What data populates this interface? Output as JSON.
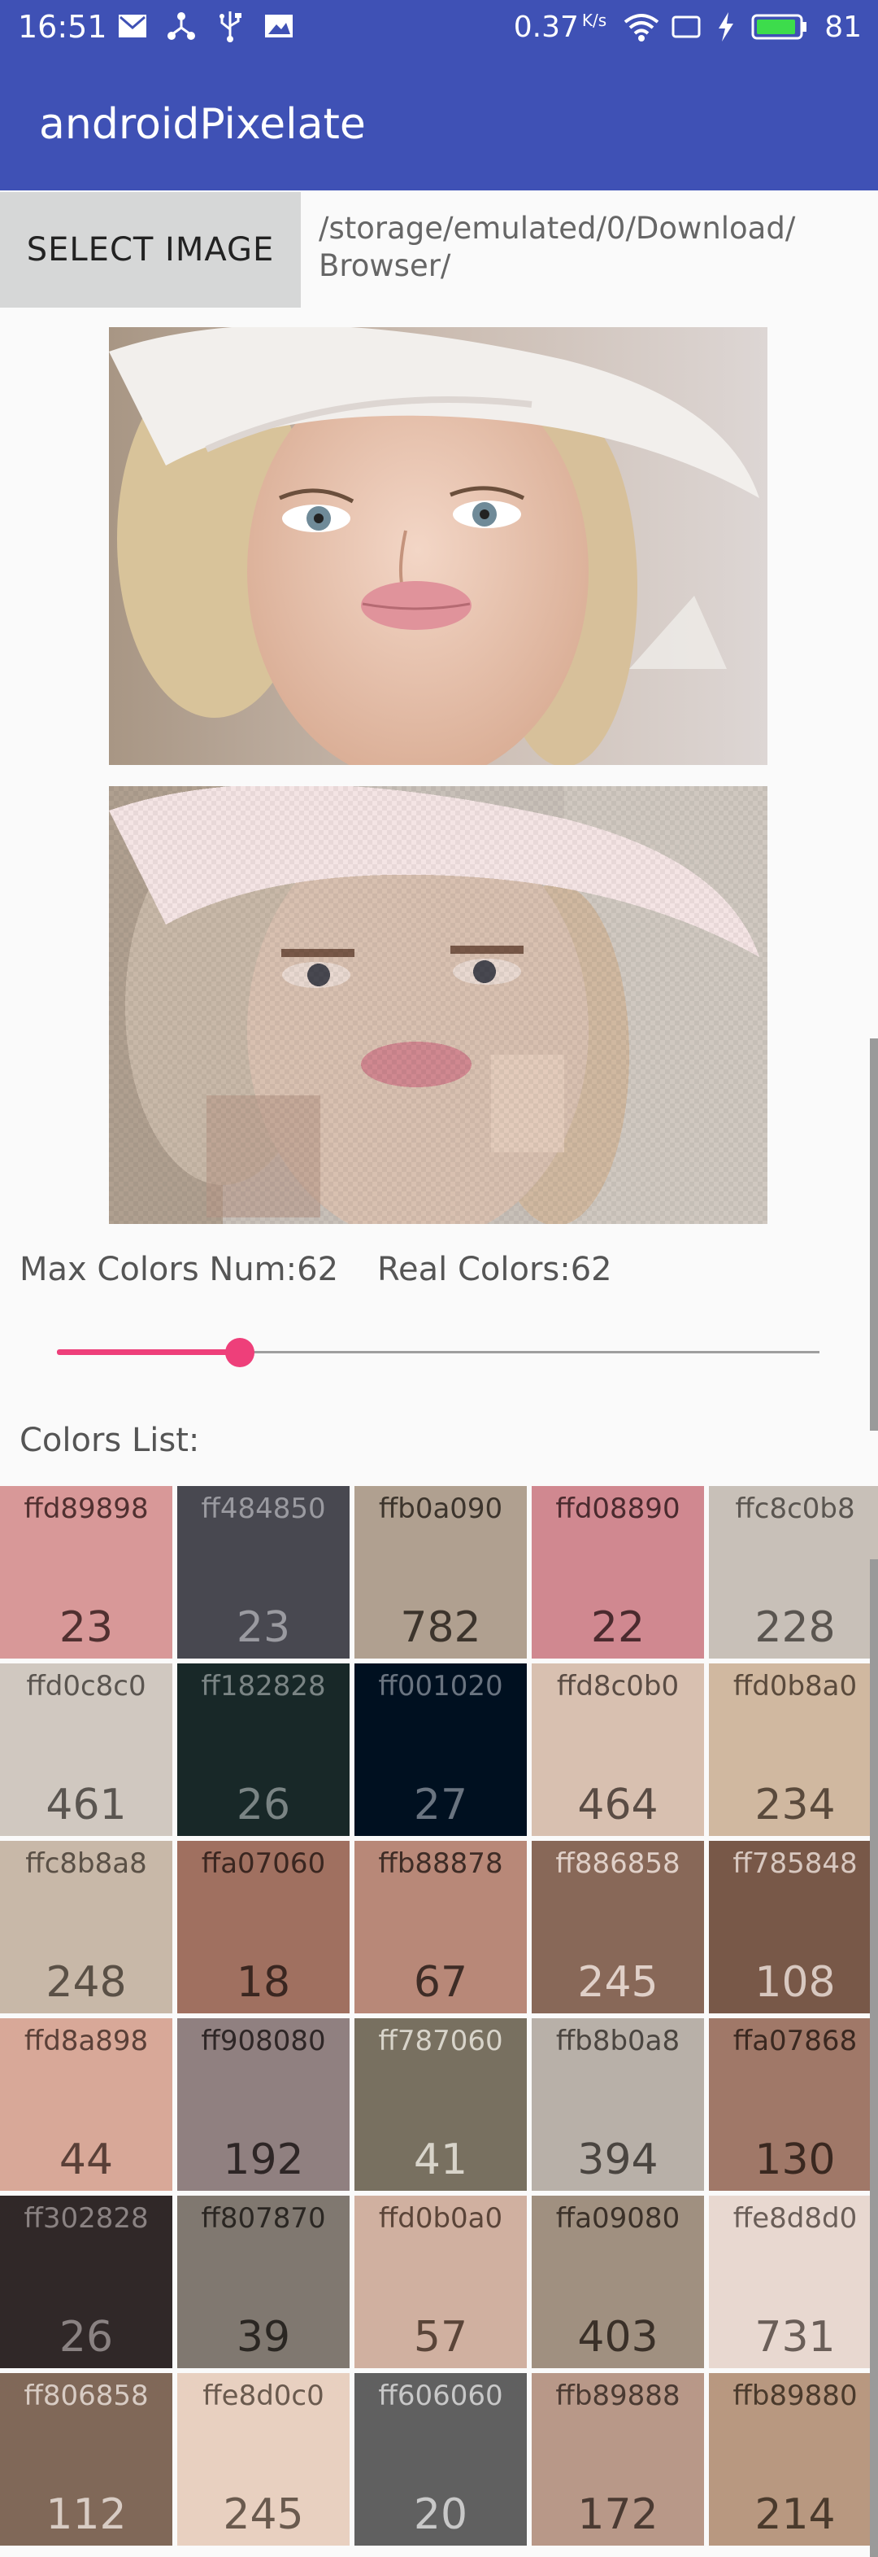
{
  "status_bar": {
    "time": "16:51",
    "speed": "0.37",
    "speed_unit": "K/s",
    "battery": "81",
    "icons_left": [
      "mail-icon",
      "share-icon",
      "usb-icon",
      "gallery-icon"
    ],
    "icons_right": [
      "wifi-icon",
      "screen-icon",
      "charging-icon",
      "battery-icon"
    ]
  },
  "app_bar": {
    "title": "androidPixelate"
  },
  "select": {
    "button_label": "SELECT IMAGE",
    "path_line1": "/storage/emulated/0/Download/",
    "path_line2": "Browser/"
  },
  "images": {
    "original": "photo-original",
    "pixelated": "photo-pixelated"
  },
  "stats": {
    "max_colors": "Max Colors Num:62",
    "real_colors": "Real Colors:62",
    "slider_fraction": 0.24
  },
  "colors_list_label": "Colors List:",
  "colors": [
    {
      "hex": "ffd89898",
      "count": "23",
      "bg": "#d89898",
      "fg": "#503030"
    },
    {
      "hex": "ff484850",
      "count": "23",
      "bg": "#484850",
      "fg": "#9a9aa0"
    },
    {
      "hex": "ffb0a090",
      "count": "782",
      "bg": "#b0a090",
      "fg": "#3c342c"
    },
    {
      "hex": "ffd08890",
      "count": "22",
      "bg": "#d08890",
      "fg": "#4a2a2e"
    },
    {
      "hex": "ffc8c0b8",
      "count": "228",
      "bg": "#c8c0b8",
      "fg": "#5a5550"
    },
    {
      "hex": "ffd0c8c0",
      "count": "461",
      "bg": "#d0c8c0",
      "fg": "#5a5550"
    },
    {
      "hex": "ff182828",
      "count": "26",
      "bg": "#182828",
      "fg": "#7a8484"
    },
    {
      "hex": "ff001020",
      "count": "27",
      "bg": "#001020",
      "fg": "#6a7480"
    },
    {
      "hex": "ffd8c0b0",
      "count": "464",
      "bg": "#d8c0b0",
      "fg": "#5a4c44"
    },
    {
      "hex": "ffd0b8a0",
      "count": "234",
      "bg": "#d0b8a0",
      "fg": "#5a4a3c"
    },
    {
      "hex": "ffc8b8a8",
      "count": "248",
      "bg": "#c8b8a8",
      "fg": "#5a5046"
    },
    {
      "hex": "ffa07060",
      "count": "18",
      "bg": "#a07060",
      "fg": "#3a2620"
    },
    {
      "hex": "ffb88878",
      "count": "67",
      "bg": "#b88878",
      "fg": "#3e2c26"
    },
    {
      "hex": "ff886858",
      "count": "245",
      "bg": "#886858",
      "fg": "#e0d0c8"
    },
    {
      "hex": "ff785848",
      "count": "108",
      "bg": "#785848",
      "fg": "#d8c8c0"
    },
    {
      "hex": "ffd8a898",
      "count": "44",
      "bg": "#d8a898",
      "fg": "#5a4038"
    },
    {
      "hex": "ff908080",
      "count": "192",
      "bg": "#908080",
      "fg": "#2e2626"
    },
    {
      "hex": "ff787060",
      "count": "41",
      "bg": "#787060",
      "fg": "#d8d4ca"
    },
    {
      "hex": "ffb8b0a8",
      "count": "394",
      "bg": "#b8b0a8",
      "fg": "#4a4540"
    },
    {
      "hex": "ffa07868",
      "count": "130",
      "bg": "#a07868",
      "fg": "#3a2820"
    },
    {
      "hex": "ff302828",
      "count": "26",
      "bg": "#302828",
      "fg": "#8a8282"
    },
    {
      "hex": "ff807870",
      "count": "39",
      "bg": "#807870",
      "fg": "#2a2622"
    },
    {
      "hex": "ffd0b0a0",
      "count": "57",
      "bg": "#d0b0a0",
      "fg": "#5a4438"
    },
    {
      "hex": "ffa09080",
      "count": "403",
      "bg": "#a09080",
      "fg": "#3a3028"
    },
    {
      "hex": "ffe8d8d0",
      "count": "731",
      "bg": "#e8d8d0",
      "fg": "#6a5e58"
    },
    {
      "hex": "ff806858",
      "count": "112",
      "bg": "#806858",
      "fg": "#d8ccc4"
    },
    {
      "hex": "ffe8d0c0",
      "count": "245",
      "bg": "#e8d0c0",
      "fg": "#6a5a4e"
    },
    {
      "hex": "ff606060",
      "count": "20",
      "bg": "#606060",
      "fg": "#c8c8c8"
    },
    {
      "hex": "ffb89888",
      "count": "172",
      "bg": "#b89888",
      "fg": "#4a3a32"
    },
    {
      "hex": "ffb89880",
      "count": "214",
      "bg": "#b89880",
      "fg": "#4a3a2c"
    }
  ]
}
